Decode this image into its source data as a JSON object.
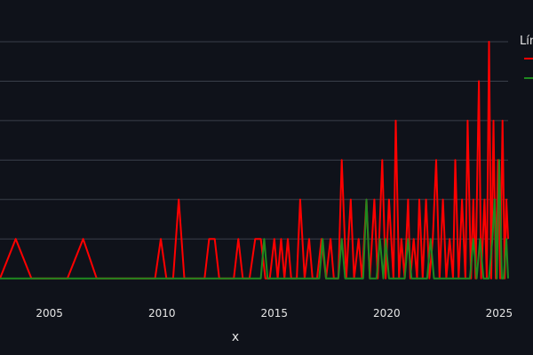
{
  "chart_data": {
    "type": "line",
    "title": "",
    "xlabel": "x",
    "ylabel": "",
    "xlim": [
      2002.8,
      2025.4
    ],
    "ylim": [
      -0.12,
      6.0
    ],
    "grid": true,
    "legend": {
      "title": "Lín",
      "position": "top-right"
    },
    "x_ticks": [
      2005,
      2010,
      2015,
      2020,
      2025
    ],
    "y_gridlines": [
      1,
      2,
      3,
      4,
      5,
      6
    ],
    "background": "#0f121a",
    "grid_color": "#3a3f4a",
    "series": [
      {
        "color": "#ff0000",
        "points": [
          [
            2002.8,
            0
          ],
          [
            2003.5,
            1
          ],
          [
            2004.2,
            0
          ],
          [
            2005.8,
            0
          ],
          [
            2006.5,
            1
          ],
          [
            2007.1,
            0
          ],
          [
            2009.7,
            0
          ],
          [
            2009.95,
            1
          ],
          [
            2010.2,
            0
          ],
          [
            2010.5,
            0
          ],
          [
            2010.75,
            2
          ],
          [
            2011.0,
            0
          ],
          [
            2011.9,
            0
          ],
          [
            2012.1,
            1
          ],
          [
            2012.35,
            1
          ],
          [
            2012.55,
            0
          ],
          [
            2013.2,
            0
          ],
          [
            2013.4,
            1
          ],
          [
            2013.6,
            0
          ],
          [
            2013.9,
            0
          ],
          [
            2014.15,
            1
          ],
          [
            2014.4,
            1
          ],
          [
            2014.6,
            0
          ],
          [
            2014.8,
            0
          ],
          [
            2015.0,
            1
          ],
          [
            2015.15,
            0
          ],
          [
            2015.3,
            1
          ],
          [
            2015.45,
            0
          ],
          [
            2015.6,
            1
          ],
          [
            2015.75,
            0
          ],
          [
            2016.0,
            0
          ],
          [
            2016.15,
            2
          ],
          [
            2016.35,
            0
          ],
          [
            2016.55,
            1
          ],
          [
            2016.7,
            0
          ],
          [
            2016.9,
            0
          ],
          [
            2017.1,
            1
          ],
          [
            2017.3,
            0
          ],
          [
            2017.5,
            1
          ],
          [
            2017.65,
            0
          ],
          [
            2017.85,
            0
          ],
          [
            2018.0,
            3
          ],
          [
            2018.2,
            0
          ],
          [
            2018.4,
            2
          ],
          [
            2018.55,
            0
          ],
          [
            2018.75,
            1
          ],
          [
            2018.9,
            0
          ],
          [
            2019.1,
            2
          ],
          [
            2019.25,
            0
          ],
          [
            2019.45,
            2
          ],
          [
            2019.6,
            0
          ],
          [
            2019.8,
            3
          ],
          [
            2019.95,
            0
          ],
          [
            2020.1,
            2
          ],
          [
            2020.3,
            0
          ],
          [
            2020.4,
            4
          ],
          [
            2020.55,
            0
          ],
          [
            2020.65,
            1
          ],
          [
            2020.8,
            0
          ],
          [
            2020.95,
            2
          ],
          [
            2021.05,
            0
          ],
          [
            2021.2,
            1
          ],
          [
            2021.35,
            0
          ],
          [
            2021.45,
            2
          ],
          [
            2021.6,
            0
          ],
          [
            2021.75,
            2
          ],
          [
            2021.9,
            0
          ],
          [
            2022.05,
            1
          ],
          [
            2022.2,
            3
          ],
          [
            2022.35,
            0
          ],
          [
            2022.5,
            2
          ],
          [
            2022.65,
            0
          ],
          [
            2022.8,
            1
          ],
          [
            2022.95,
            0
          ],
          [
            2023.05,
            3
          ],
          [
            2023.2,
            0
          ],
          [
            2023.35,
            2
          ],
          [
            2023.5,
            0
          ],
          [
            2023.6,
            4
          ],
          [
            2023.75,
            0
          ],
          [
            2023.85,
            2
          ],
          [
            2023.95,
            0
          ],
          [
            2024.1,
            5
          ],
          [
            2024.2,
            0
          ],
          [
            2024.35,
            2
          ],
          [
            2024.45,
            0
          ],
          [
            2024.55,
            6
          ],
          [
            2024.65,
            0
          ],
          [
            2024.75,
            4
          ],
          [
            2024.85,
            0
          ],
          [
            2024.95,
            3
          ],
          [
            2025.05,
            0
          ],
          [
            2025.15,
            4
          ],
          [
            2025.25,
            0
          ],
          [
            2025.32,
            2
          ],
          [
            2025.4,
            1
          ]
        ]
      },
      {
        "color": "#1f8a1f",
        "points": [
          [
            2002.8,
            0
          ],
          [
            2014.4,
            0
          ],
          [
            2014.55,
            1
          ],
          [
            2014.7,
            0
          ],
          [
            2017.0,
            0
          ],
          [
            2017.15,
            1
          ],
          [
            2017.3,
            0
          ],
          [
            2017.85,
            0
          ],
          [
            2018.0,
            1
          ],
          [
            2018.15,
            0
          ],
          [
            2018.95,
            0
          ],
          [
            2019.1,
            2
          ],
          [
            2019.25,
            0
          ],
          [
            2019.55,
            0
          ],
          [
            2019.7,
            1
          ],
          [
            2019.85,
            0
          ],
          [
            2019.95,
            1
          ],
          [
            2020.1,
            0
          ],
          [
            2020.8,
            0
          ],
          [
            2020.95,
            1
          ],
          [
            2021.1,
            0
          ],
          [
            2021.8,
            0
          ],
          [
            2021.95,
            1
          ],
          [
            2022.1,
            0
          ],
          [
            2023.7,
            0
          ],
          [
            2023.85,
            1
          ],
          [
            2024.0,
            0
          ],
          [
            2024.15,
            1
          ],
          [
            2024.3,
            0
          ],
          [
            2024.55,
            0
          ],
          [
            2024.7,
            1
          ],
          [
            2024.8,
            2
          ],
          [
            2024.9,
            0
          ],
          [
            2025.0,
            3
          ],
          [
            2025.12,
            0
          ],
          [
            2025.2,
            0
          ],
          [
            2025.32,
            1
          ],
          [
            2025.4,
            0
          ]
        ]
      }
    ]
  }
}
